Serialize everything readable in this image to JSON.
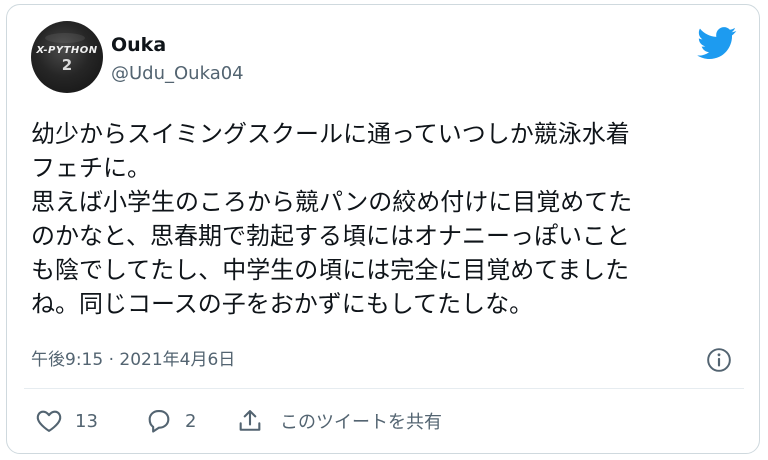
{
  "tweet": {
    "author": {
      "display_name": "Ouka",
      "handle": "@Udu_Ouka04",
      "avatar_text": [
        "X-PYTHON",
        "2"
      ]
    },
    "text_lines": [
      "幼少からスイミングスクールに通っていつしか競泳水着",
      "フェチに。",
      "思えば小学生のころから競パンの絞め付けに目覚めてた",
      "のかなと、思春期で勃起する頃にはオナニーっぽいこと",
      "も陰でしてたし、中学生の頃には完全に目覚めてました",
      "ね。同じコースの子をおかずにもしてたしな。"
    ],
    "timestamp": "午後9:15 · 2021年4月6日",
    "actions": {
      "likes": "13",
      "replies": "2",
      "share_label": "このツイートを共有"
    }
  },
  "colors": {
    "twitter_blue": "#1d9bf0",
    "secondary_text": "#536471",
    "border": "#cfd9de"
  },
  "icons": [
    "twitter-bird-icon",
    "info-icon",
    "heart-icon",
    "reply-bubble-icon",
    "share-icon"
  ]
}
